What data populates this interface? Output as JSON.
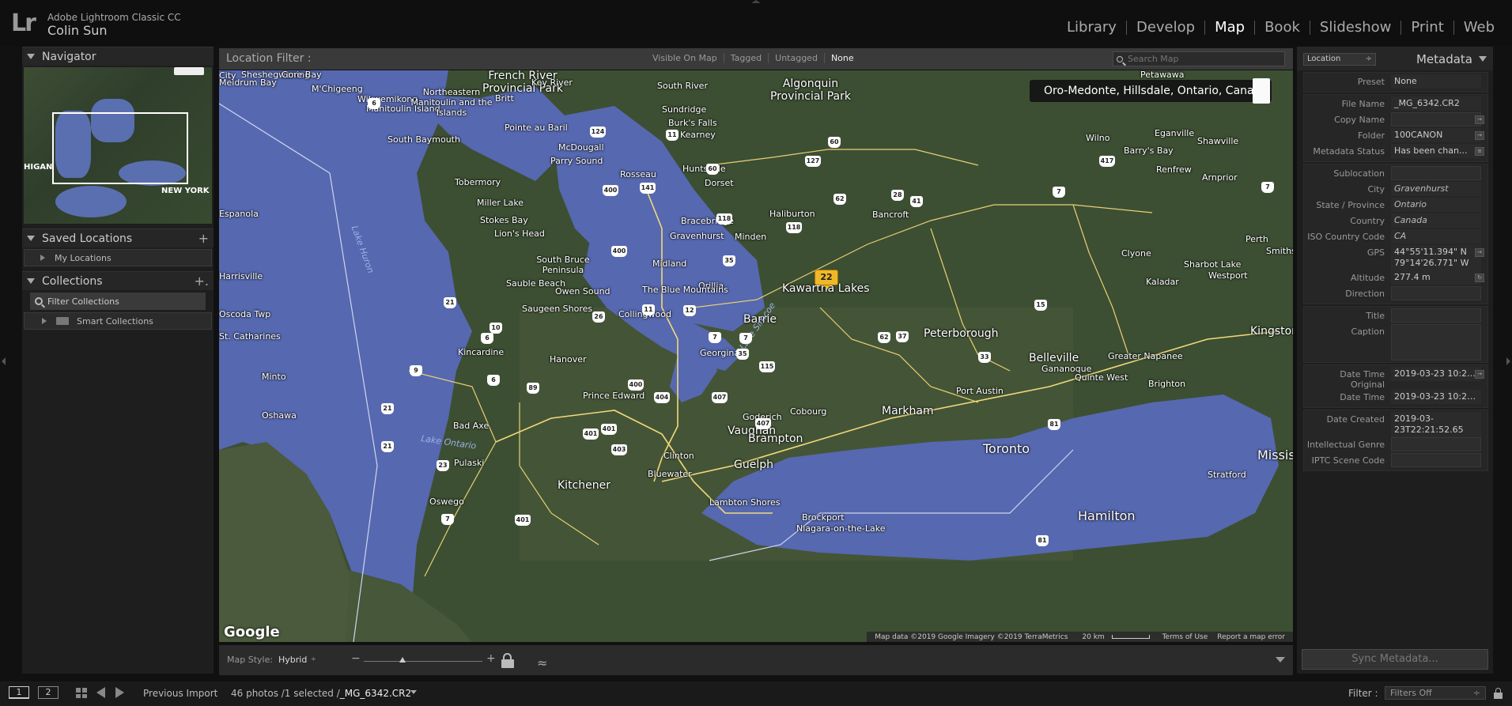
{
  "app": {
    "logo": "Lr",
    "name": "Adobe Lightroom Classic CC",
    "user": "Colin Sun"
  },
  "modules": [
    {
      "label": "Library",
      "active": false
    },
    {
      "label": "Develop",
      "active": false
    },
    {
      "label": "Map",
      "active": true
    },
    {
      "label": "Book",
      "active": false
    },
    {
      "label": "Slideshow",
      "active": false
    },
    {
      "label": "Print",
      "active": false
    },
    {
      "label": "Web",
      "active": false
    }
  ],
  "left_panel": {
    "navigator": {
      "title": "Navigator",
      "labels": {
        "michigan": "HIGAN",
        "new_york": "NEW YORK"
      }
    },
    "saved_locations": {
      "title": "Saved Locations",
      "add": "+",
      "items": [
        "My Locations"
      ]
    },
    "collections": {
      "title": "Collections",
      "add": "+.",
      "filter": "Filter Collections",
      "items": [
        "Smart Collections"
      ]
    }
  },
  "map_filter": {
    "label": "Location Filter :",
    "options": [
      {
        "label": "Visible On Map",
        "active": false
      },
      {
        "label": "Tagged",
        "active": false
      },
      {
        "label": "Untagged",
        "active": false
      },
      {
        "label": "None",
        "active": true
      }
    ],
    "search_placeholder": "Search Map"
  },
  "map": {
    "tooltip": "Oro-Medonte, Hillsdale, Ontario, Canada",
    "cluster_count": "22",
    "google_logo": "Google",
    "attribution": {
      "data": "Map data ©2019 Google Imagery ©2019 TerraMetrics",
      "scale": "20 km",
      "terms": "Terms of Use",
      "report": "Report a map error"
    },
    "labels": [
      {
        "text": "Sheshegwaning",
        "cls": ""
      },
      {
        "text": "Gore Bay",
        "cls": ""
      },
      {
        "text": "Meldrum Bay",
        "cls": ""
      },
      {
        "text": "M'Chigeeng",
        "cls": ""
      },
      {
        "text": "Wikwemikong",
        "cls": ""
      },
      {
        "text": "Manitoulin Island",
        "cls": ""
      },
      {
        "text": "Northeastern Manitoulin and the Islands",
        "cls": ""
      },
      {
        "text": "French River Provincial Park",
        "cls": "big"
      },
      {
        "text": "Key River",
        "cls": ""
      },
      {
        "text": "Britt",
        "cls": ""
      },
      {
        "text": "South River",
        "cls": ""
      },
      {
        "text": "Sundridge",
        "cls": ""
      },
      {
        "text": "Burk's Falls",
        "cls": ""
      },
      {
        "text": "Kearney",
        "cls": ""
      },
      {
        "text": "Algonquin Provincial Park",
        "cls": "big"
      },
      {
        "text": "Petawawa",
        "cls": ""
      },
      {
        "text": "Pointe au Baril",
        "cls": ""
      },
      {
        "text": "McDougall",
        "cls": ""
      },
      {
        "text": "Parry Sound",
        "cls": ""
      },
      {
        "text": "Rosseau",
        "cls": ""
      },
      {
        "text": "Huntsville",
        "cls": ""
      },
      {
        "text": "Dorset",
        "cls": ""
      },
      {
        "text": "Eganville",
        "cls": ""
      },
      {
        "text": "Shawville",
        "cls": ""
      },
      {
        "text": "Wilno",
        "cls": ""
      },
      {
        "text": "Barry's Bay",
        "cls": ""
      },
      {
        "text": "Renfrew",
        "cls": ""
      },
      {
        "text": "Arnprior",
        "cls": ""
      },
      {
        "text": "South Baymouth",
        "cls": ""
      },
      {
        "text": "Tobermory",
        "cls": ""
      },
      {
        "text": "Miller Lake",
        "cls": ""
      },
      {
        "text": "Stokes Bay",
        "cls": ""
      },
      {
        "text": "Lion's Head",
        "cls": ""
      },
      {
        "text": "Bracebridge",
        "cls": ""
      },
      {
        "text": "Gravenhurst",
        "cls": ""
      },
      {
        "text": "Haliburton",
        "cls": ""
      },
      {
        "text": "Bancroft",
        "cls": ""
      },
      {
        "text": "Minden",
        "cls": ""
      },
      {
        "text": "Perth",
        "cls": ""
      },
      {
        "text": "Smiths",
        "cls": ""
      },
      {
        "text": "Lake Huron",
        "cls": "water"
      },
      {
        "text": "Espanola",
        "cls": ""
      },
      {
        "text": "South Bruce Peninsula",
        "cls": ""
      },
      {
        "text": "Midland",
        "cls": ""
      },
      {
        "text": "Orillia",
        "cls": ""
      },
      {
        "text": "Kawartha Lakes",
        "cls": "big"
      },
      {
        "text": "Clyone",
        "cls": ""
      },
      {
        "text": "Sharbot Lake",
        "cls": ""
      },
      {
        "text": "Kaladar",
        "cls": ""
      },
      {
        "text": "Westport",
        "cls": ""
      },
      {
        "text": "Harrisville",
        "cls": ""
      },
      {
        "text": "Sauble Beach",
        "cls": ""
      },
      {
        "text": "Owen Sound",
        "cls": ""
      },
      {
        "text": "The Blue Mountains",
        "cls": ""
      },
      {
        "text": "Saugeen Shores",
        "cls": ""
      },
      {
        "text": "Collingwood",
        "cls": ""
      },
      {
        "text": "Barrie",
        "cls": "big"
      },
      {
        "text": "Lake Simcoe",
        "cls": "water"
      },
      {
        "text": "Peterborough",
        "cls": "big"
      },
      {
        "text": "Oscoda Twp",
        "cls": ""
      },
      {
        "text": "Kincardine",
        "cls": ""
      },
      {
        "text": "Hanover",
        "cls": ""
      },
      {
        "text": "Georgina",
        "cls": ""
      },
      {
        "text": "Belleville",
        "cls": "big"
      },
      {
        "text": "Greater Napanee",
        "cls": ""
      },
      {
        "text": "Kingston",
        "cls": "big"
      },
      {
        "text": "Gananoque",
        "cls": ""
      },
      {
        "text": "Quinte West",
        "cls": ""
      },
      {
        "text": "Brighton",
        "cls": ""
      },
      {
        "text": "Prince Edward",
        "cls": ""
      },
      {
        "text": "Minto",
        "cls": ""
      },
      {
        "text": "Port Austin",
        "cls": ""
      },
      {
        "text": "Cobourg",
        "cls": ""
      },
      {
        "text": "Markham",
        "cls": "big"
      },
      {
        "text": "Oshawa",
        "cls": ""
      },
      {
        "text": "Bad Axe",
        "cls": ""
      },
      {
        "text": "Goderich",
        "cls": ""
      },
      {
        "text": "Vaughan",
        "cls": "big"
      },
      {
        "text": "Brampton",
        "cls": "big"
      },
      {
        "text": "Toronto",
        "cls": "bigger"
      },
      {
        "text": "Lake Ontario",
        "cls": "water"
      },
      {
        "text": "Clinton",
        "cls": ""
      },
      {
        "text": "Guelph",
        "cls": "big"
      },
      {
        "text": "Mississauga",
        "cls": "bigger"
      },
      {
        "text": "Pulaski",
        "cls": ""
      },
      {
        "text": "Bluewater",
        "cls": ""
      },
      {
        "text": "Kitchener",
        "cls": "big"
      },
      {
        "text": "Stratford",
        "cls": ""
      },
      {
        "text": "Oswego",
        "cls": ""
      },
      {
        "text": "Lambton Shores",
        "cls": ""
      },
      {
        "text": "Hamilton",
        "cls": "bigger"
      },
      {
        "text": "Brockport",
        "cls": ""
      },
      {
        "text": "Niagara-on-the-Lake",
        "cls": ""
      },
      {
        "text": "St. Catharines",
        "cls": ""
      },
      {
        "text": "City",
        "cls": ""
      }
    ],
    "shields": [
      "6",
      "124",
      "11",
      "60",
      "400",
      "141",
      "60",
      "127",
      "62",
      "28",
      "41",
      "417",
      "7",
      "118",
      "118",
      "400",
      "35",
      "21",
      "10",
      "6",
      "26",
      "11",
      "12",
      "7",
      "7",
      "62",
      "37",
      "33",
      "15",
      "9",
      "6",
      "89",
      "7",
      "35",
      "115",
      "400",
      "404",
      "407",
      "401",
      "21",
      "407",
      "401",
      "403",
      "21",
      "23",
      "7",
      "401",
      "81",
      "81"
    ]
  },
  "map_toolbar": {
    "style_label": "Map Style:",
    "style_value": "Hybrid",
    "style_chevron": "÷",
    "zoom_minus": "−",
    "zoom_plus": "+",
    "tracklog": "≈"
  },
  "metadata": {
    "preset_select": "Location",
    "title": "Metadata",
    "preset": {
      "label": "Preset",
      "value": "None"
    },
    "file_block": [
      {
        "label": "File Name",
        "value": "_MG_6342.CR2",
        "italic": false,
        "action": ""
      },
      {
        "label": "Copy Name",
        "value": "",
        "italic": false,
        "action": "→"
      },
      {
        "label": "Folder",
        "value": "100CANON",
        "italic": false,
        "action": "→"
      },
      {
        "label": "Metadata Status",
        "value": "Has been chan...",
        "italic": false,
        "action": "≡"
      }
    ],
    "location_block": [
      {
        "label": "Sublocation",
        "value": "",
        "italic": false,
        "action": ""
      },
      {
        "label": "City",
        "value": "Gravenhurst",
        "italic": true,
        "action": ""
      },
      {
        "label": "State / Province",
        "value": "Ontario",
        "italic": true,
        "action": ""
      },
      {
        "label": "Country",
        "value": "Canada",
        "italic": true,
        "action": ""
      },
      {
        "label": "ISO Country Code",
        "value": "CA",
        "italic": true,
        "action": ""
      },
      {
        "label": "GPS",
        "value": "44°55'11.394\" N 79°14'26.771\" W",
        "italic": false,
        "action": "→"
      },
      {
        "label": "Altitude",
        "value": "277.4 m",
        "italic": false,
        "action": "↻"
      },
      {
        "label": "Direction",
        "value": "",
        "italic": false,
        "action": ""
      }
    ],
    "title_block": [
      {
        "label": "Title",
        "value": ""
      },
      {
        "label": "Caption",
        "value": ""
      }
    ],
    "date_block": [
      {
        "label": "Date Time Original",
        "value": "2019-03-23 10:2...",
        "action": "→"
      },
      {
        "label": "Date Time",
        "value": "2019-03-23 10:21:52...",
        "action": ""
      }
    ],
    "iptc_block": [
      {
        "label": "Date Created",
        "value": "2019-03-23T22:21:52.65"
      },
      {
        "label": "Intellectual Genre",
        "value": ""
      },
      {
        "label": "IPTC Scene Code",
        "value": ""
      }
    ],
    "sync_button": "Sync Metadata..."
  },
  "filmstrip": {
    "screen1": "1",
    "screen2": "2",
    "source": "Previous Import",
    "count": "46 photos /1 selected /",
    "photo": "_MG_6342.CR2",
    "filter_label": "Filter :",
    "filter_value": "Filters Off"
  }
}
